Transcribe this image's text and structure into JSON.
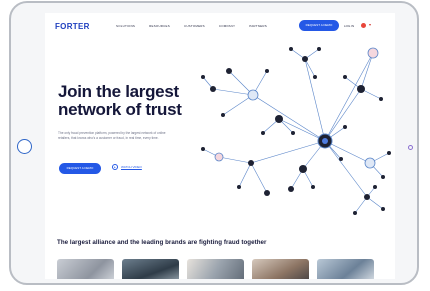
{
  "brand": {
    "logo": "FORTER"
  },
  "nav": {
    "items": [
      "SOLUTIONS",
      "RESOURCES",
      "CUSTOMERS",
      "COMPANY",
      "PARTNERS"
    ],
    "demo_label": "REQUEST A DEMO",
    "login_label": "LOG IN"
  },
  "hero": {
    "title_line1": "Join the largest",
    "title_line2": "network of trust",
    "subtitle": "The only fraud prevention platform, powered by the largest network of online retailers, that knows who's a customer or fraud, in real time, every time.",
    "cta_label": "REQUEST A DEMO",
    "watch_label": "WATCH VIDEO"
  },
  "alliance": {
    "heading": "The largest alliance and the leading brands are fighting fraud together"
  },
  "photos": [
    "photo-1",
    "photo-2",
    "photo-3",
    "photo-4",
    "photo-5"
  ],
  "colors": {
    "accent": "#2458e6",
    "heading": "#15173a",
    "network_node": "#1e2233",
    "network_edge": "#5b86c9"
  }
}
